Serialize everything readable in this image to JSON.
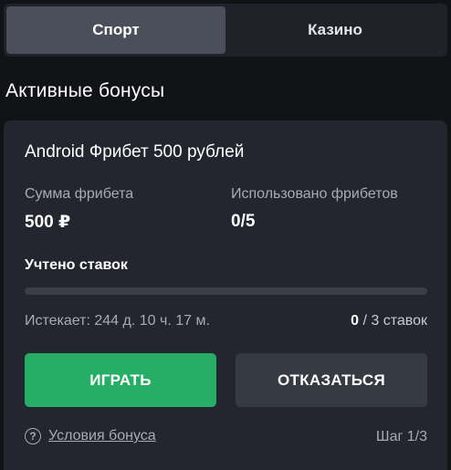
{
  "tabs": [
    {
      "label": "Спорт",
      "active": true
    },
    {
      "label": "Казино",
      "active": false
    }
  ],
  "section_title": "Активные бонусы",
  "bonus": {
    "title": "Android Фрибет 500 рублей",
    "amount_label": "Сумма фрибета",
    "amount_value": "500 ₽",
    "used_label": "Использовано фрибетов",
    "used_value": "0/5",
    "bets_label": "Учтено ставок",
    "progress_fraction": 0,
    "expires": "Истекает: 244 д. 10 ч. 17 м.",
    "bets_done": "0",
    "bets_total": " / 3 ставок",
    "play_button": "ИГРАТЬ",
    "decline_button": "ОТКАЗАТЬСЯ",
    "help_icon_glyph": "?",
    "terms_link": "Условия бонуса",
    "step": "Шаг 1/3"
  },
  "colors": {
    "accent_green": "#27ae66",
    "background": "#111317",
    "card": "#23262e"
  }
}
